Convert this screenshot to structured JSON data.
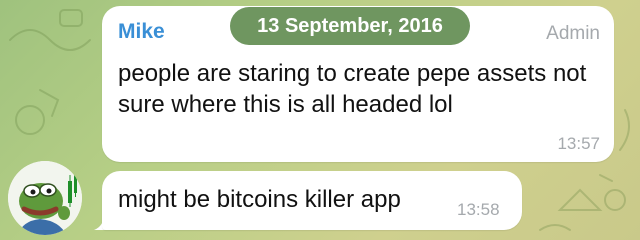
{
  "date_divider": "13 September, 2016",
  "messages": [
    {
      "sender": "Mike",
      "role": "Admin",
      "text": "people are staring to create pepe assets not sure where this is all headed lol",
      "time": "13:57"
    },
    {
      "text": "might be bitcoins killer app",
      "time": "13:58"
    }
  ],
  "avatar": {
    "icon": "pepe-frog-avatar"
  },
  "colors": {
    "background": "#b5cd86",
    "sender_name": "#3a8fd6",
    "date_pill": "#6f9660",
    "meta_text": "#a5a9ad",
    "bubble": "#ffffff"
  }
}
